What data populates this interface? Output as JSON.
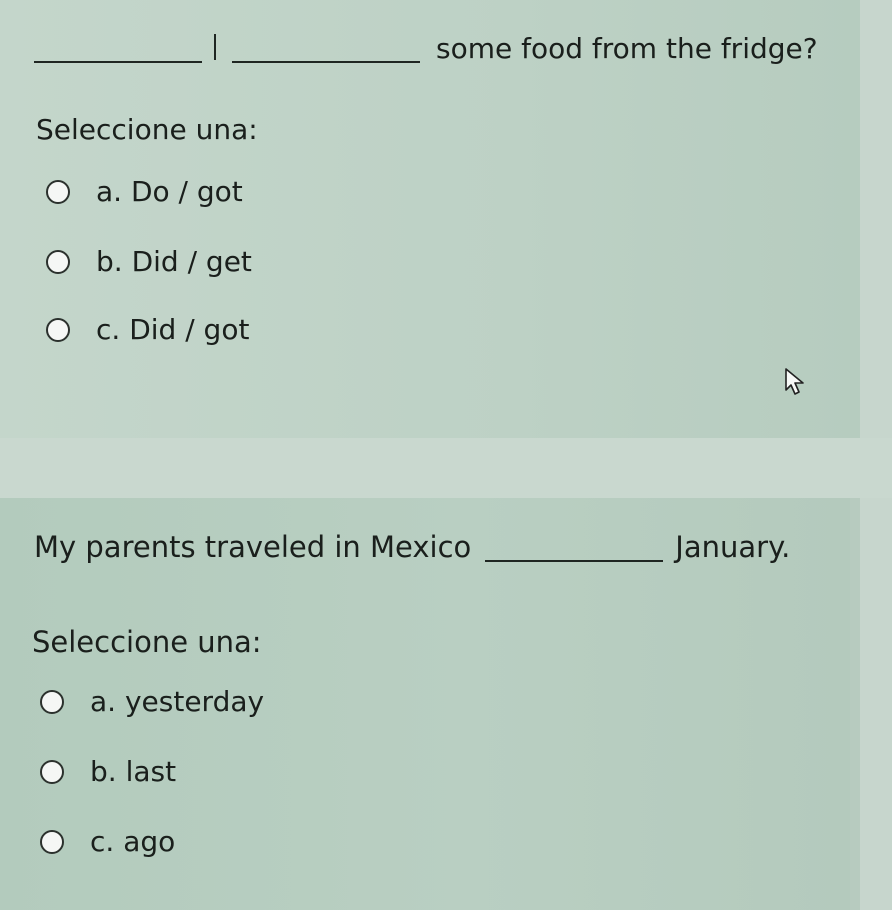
{
  "question1": {
    "text_after_blanks": "some food from the fridge?",
    "prompt": "Seleccione una:",
    "options": [
      {
        "label": "a. Do / got"
      },
      {
        "label": "b. Did / get"
      },
      {
        "label": "c. Did / got"
      }
    ]
  },
  "question2": {
    "text_before_blank": "My parents traveled in Mexico",
    "text_after_blank": "January.",
    "prompt": "Seleccione una:",
    "options": [
      {
        "label": "a. yesterday"
      },
      {
        "label": "b. last"
      },
      {
        "label": "c. ago"
      }
    ]
  },
  "icons": {
    "cursor": "mouse-pointer-icon"
  }
}
